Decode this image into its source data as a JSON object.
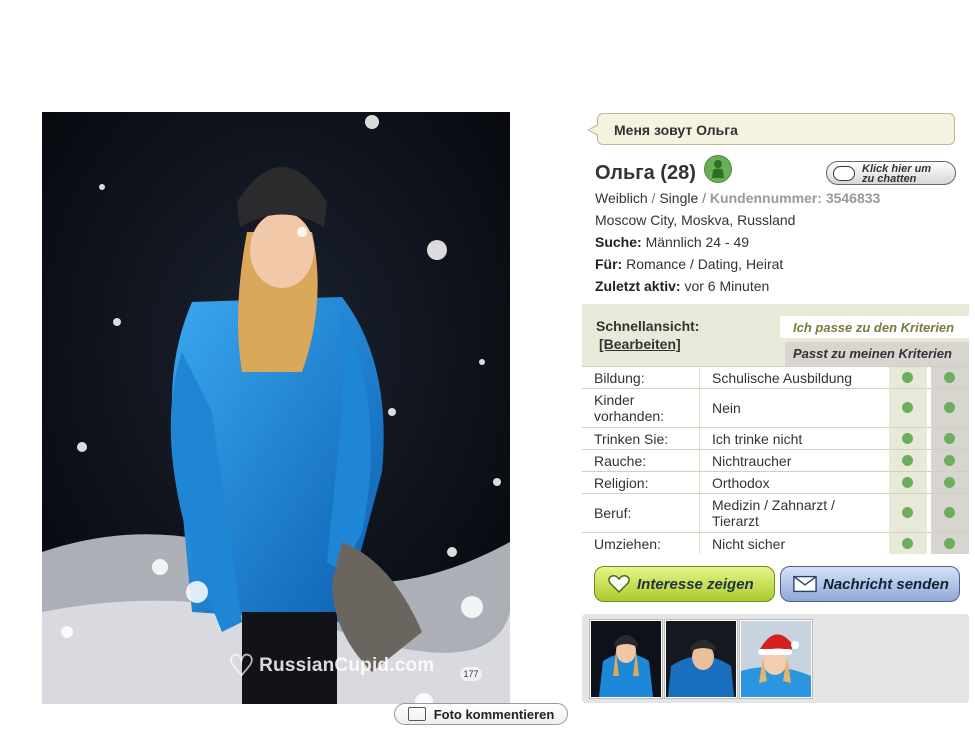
{
  "bubble": {
    "text": "Меня зовут Ольга"
  },
  "profile": {
    "name_age": "Ольга (28)",
    "gender": "Weiblich",
    "status": "Single",
    "customer_label": "Kundennummer:",
    "customer_id": "3546833",
    "location": "Moscow City, Moskva, Russland",
    "seeking_label": "Suche:",
    "seeking_value": "Männlich 24 - 49",
    "for_label": "Für:",
    "for_value": "Romance / Dating, Heirat",
    "last_active_label": "Zuletzt aktiv:",
    "last_active_value": "vor 6 Minuten"
  },
  "chat_button": {
    "line1": "Klick hier um",
    "line2": "zu chatten"
  },
  "quickview": {
    "title": "Schnellansicht:",
    "edit": "[Bearbeiten]",
    "criteria_mine": "Ich passe zu den Kriterien",
    "criteria_theirs": "Passt zu meinen Kriterien",
    "rows": [
      {
        "label": "Bildung:",
        "value": "Schulische Ausbildung"
      },
      {
        "label": "Kinder vorhanden:",
        "value": "Nein"
      },
      {
        "label": "Trinken Sie:",
        "value": "Ich trinke nicht"
      },
      {
        "label": "Rauche:",
        "value": "Nichtraucher"
      },
      {
        "label": "Religion:",
        "value": "Orthodox"
      },
      {
        "label": "Beruf:",
        "value": "Medizin / Zahnarzt / Tierarzt"
      },
      {
        "label": "Umziehen:",
        "value": "Nicht sicher"
      }
    ]
  },
  "buttons": {
    "interest": "Interesse zeigen",
    "message": "Nachricht senden",
    "comment_photo": "Foto kommentieren"
  },
  "photo": {
    "watermark": "RussianCupid.com",
    "count": "177"
  },
  "colors": {
    "match_dot": "#6cae5c",
    "interest_green": "#aacb2a",
    "message_blue": "#8ea8d6",
    "panel_beige": "#e9e9d9"
  }
}
